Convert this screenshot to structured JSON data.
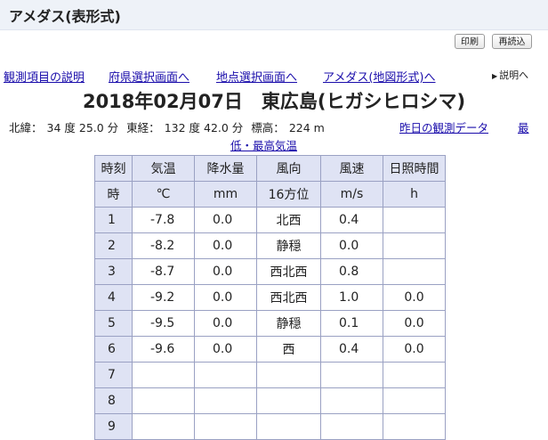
{
  "header": {
    "title": "アメダス(表形式)",
    "print_label": "印刷",
    "reload_label": "再読込"
  },
  "nav": {
    "links": [
      "観測項目の説明",
      "府県選択画面へ",
      "地点選択画面へ",
      "アメダス(地図形式)へ"
    ],
    "help_label": "説明へ",
    "help_icon": "triangle-right-icon"
  },
  "heading": "2018年02月07日　東広島(ヒガシヒロシマ)",
  "station": {
    "lat_label": "北緯：",
    "lat_value": "34 度 25.0 分",
    "lon_label": "東経：",
    "lon_value": "132 度 42.0 分",
    "alt_label": "標高：",
    "alt_value": "224 m",
    "yesterday_link": "昨日の観測データ",
    "minmax_link_a": "最",
    "minmax_link_b": "低・最高気温"
  },
  "table": {
    "headers": [
      "時刻",
      "気温",
      "降水量",
      "風向",
      "風速",
      "日照時間"
    ],
    "units": [
      "時",
      "℃",
      "mm",
      "16方位",
      "m/s",
      "h"
    ],
    "rows": [
      [
        "1",
        "-7.8",
        "0.0",
        "北西",
        "0.4",
        ""
      ],
      [
        "2",
        "-8.2",
        "0.0",
        "静穏",
        "0.0",
        ""
      ],
      [
        "3",
        "-8.7",
        "0.0",
        "西北西",
        "0.8",
        ""
      ],
      [
        "4",
        "-9.2",
        "0.0",
        "西北西",
        "1.0",
        "0.0"
      ],
      [
        "5",
        "-9.5",
        "0.0",
        "静穏",
        "0.1",
        "0.0"
      ],
      [
        "6",
        "-9.6",
        "0.0",
        "西",
        "0.4",
        "0.0"
      ],
      [
        "7",
        "",
        "",
        "",
        "",
        ""
      ],
      [
        "8",
        "",
        "",
        "",
        "",
        ""
      ],
      [
        "9",
        "",
        "",
        "",
        "",
        ""
      ]
    ]
  },
  "colors": {
    "link": "#1a0dab",
    "title_bar": "#eef2f8",
    "table_header": "#dfe3f4",
    "table_border": "#9aa1c3"
  }
}
